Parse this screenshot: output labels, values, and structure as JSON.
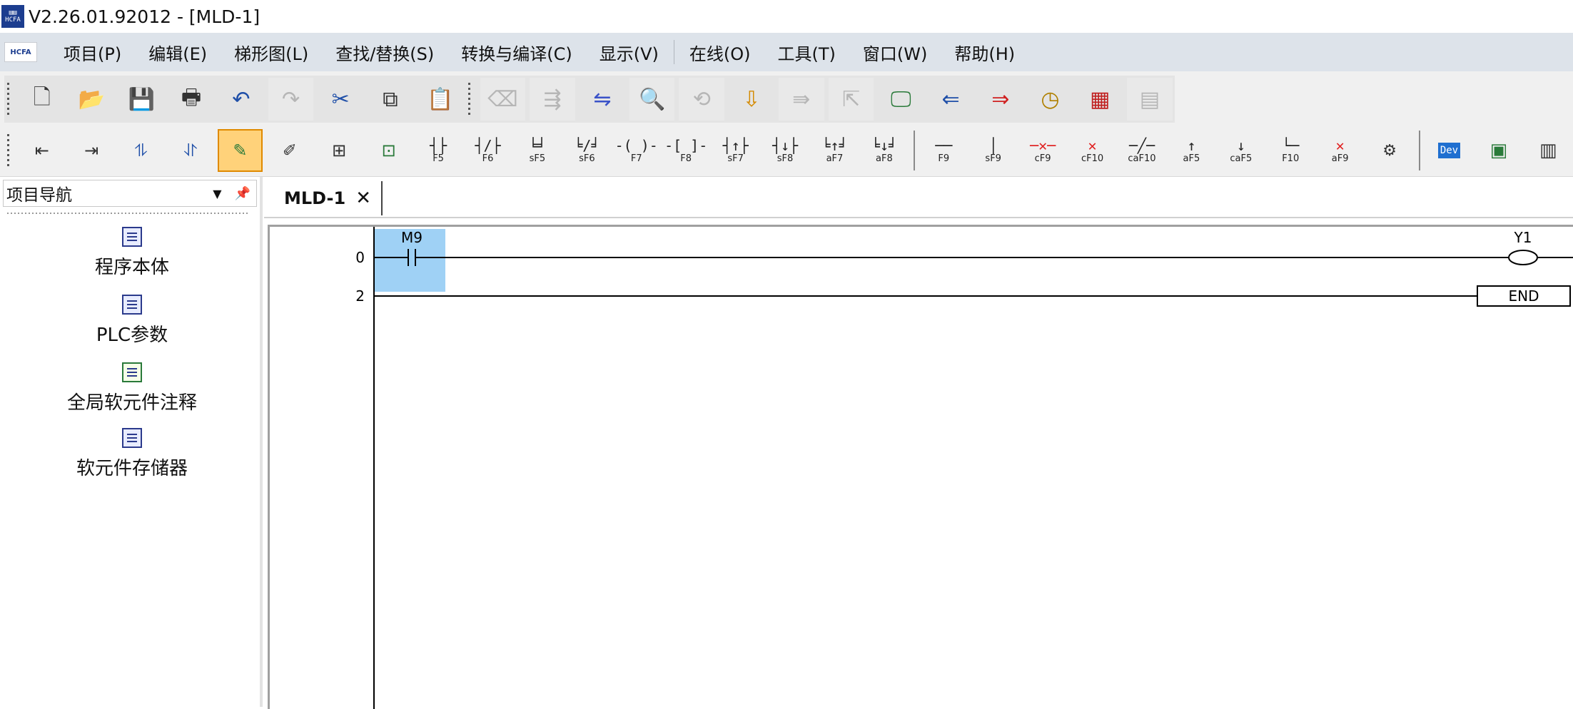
{
  "window": {
    "title": "V2.26.01.92012 - [MLD-1]",
    "logo_text": "HCFA"
  },
  "menubar": {
    "items": [
      "项目(P)",
      "编辑(E)",
      "梯形图(L)",
      "查找/替换(S)",
      "转换与编译(C)",
      "显示(V)",
      "在线(O)",
      "工具(T)",
      "窗口(W)",
      "帮助(H)"
    ]
  },
  "toolbar_ladder": {
    "keys": [
      "F5",
      "F6",
      "sF5",
      "sF6",
      "F7",
      "F8",
      "sF7",
      "sF8",
      "aF7",
      "aF8"
    ],
    "line_keys": [
      "F9",
      "sF9",
      "cF9",
      "cF10",
      "caF10",
      "aF5",
      "caF5",
      "F10",
      "aF9"
    ],
    "right_labels": [
      "Dev"
    ]
  },
  "nav": {
    "title": "项目导航",
    "items": [
      "程序本体",
      "PLC参数",
      "全局软元件注释",
      "软元件存储器"
    ]
  },
  "tab": {
    "label": "MLD-1",
    "close": "✕"
  },
  "ladder": {
    "rungs": [
      {
        "step": "0",
        "contact": "M9",
        "coil": "Y1"
      },
      {
        "step": "2",
        "instruction": "END"
      }
    ]
  },
  "colors": {
    "selection": "#9fd1f5",
    "accent": "#ffd27a",
    "menu_bg": "#dde3ea"
  }
}
